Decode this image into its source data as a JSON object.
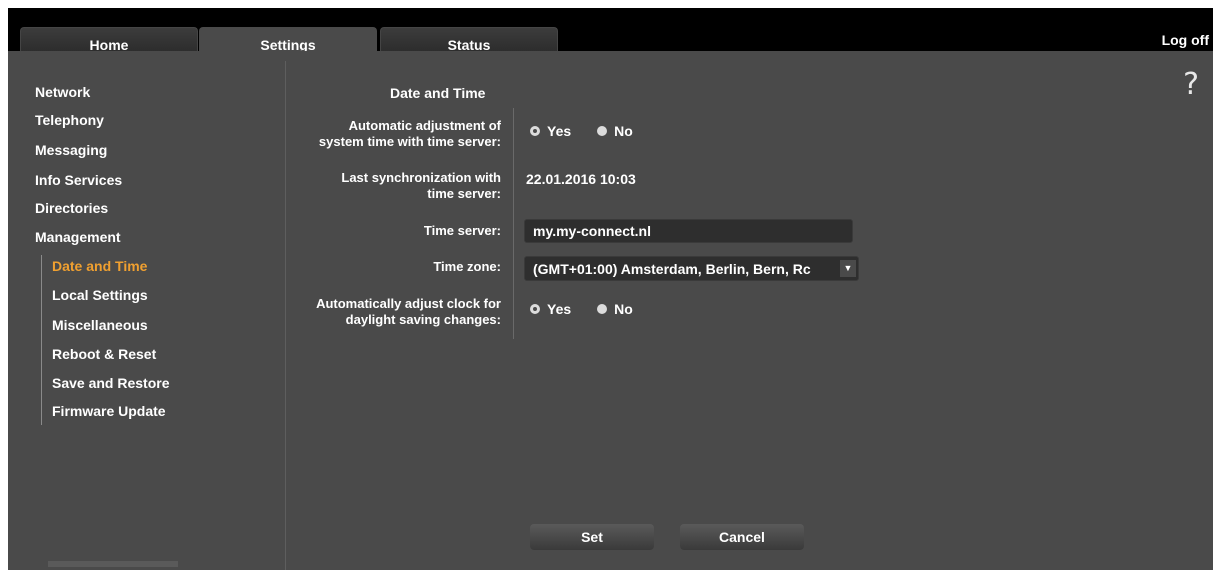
{
  "tabs": [
    {
      "label": "Home"
    },
    {
      "label": "Settings"
    },
    {
      "label": "Status"
    }
  ],
  "logoff_label": "Log off",
  "help_label": "?",
  "nav": {
    "items": [
      {
        "label": "Network"
      },
      {
        "label": "Telephony"
      },
      {
        "label": "Messaging"
      },
      {
        "label": "Info Services"
      },
      {
        "label": "Directories"
      },
      {
        "label": "Management"
      }
    ],
    "sub_items": [
      {
        "label": "Date and Time",
        "active": true
      },
      {
        "label": "Local Settings"
      },
      {
        "label": "Miscellaneous"
      },
      {
        "label": "Reboot & Reset"
      },
      {
        "label": "Save and Restore"
      },
      {
        "label": "Firmware Update"
      }
    ]
  },
  "form": {
    "title": "Date and Time",
    "auto_adjust": {
      "label_line1": "Automatic adjustment of",
      "label_line2": "system time with time server:",
      "yes": "Yes",
      "no": "No",
      "selected": "Yes"
    },
    "last_sync": {
      "label_line1": "Last synchronization with",
      "label_line2": "time server:",
      "value": "22.01.2016 10:03"
    },
    "time_server": {
      "label": "Time server:",
      "value": "my.my-connect.nl"
    },
    "time_zone": {
      "label": "Time zone:",
      "value": "(GMT+01:00) Amsterdam, Berlin, Bern, Rc"
    },
    "dst": {
      "label_line1": "Automatically adjust clock for",
      "label_line2": "daylight saving changes:",
      "yes": "Yes",
      "no": "No",
      "selected": "Yes"
    }
  },
  "buttons": {
    "set": "Set",
    "cancel": "Cancel"
  },
  "colors": {
    "panel": "#4a4a4a",
    "topbar": "#000000",
    "active_nav": "#f0a030"
  }
}
